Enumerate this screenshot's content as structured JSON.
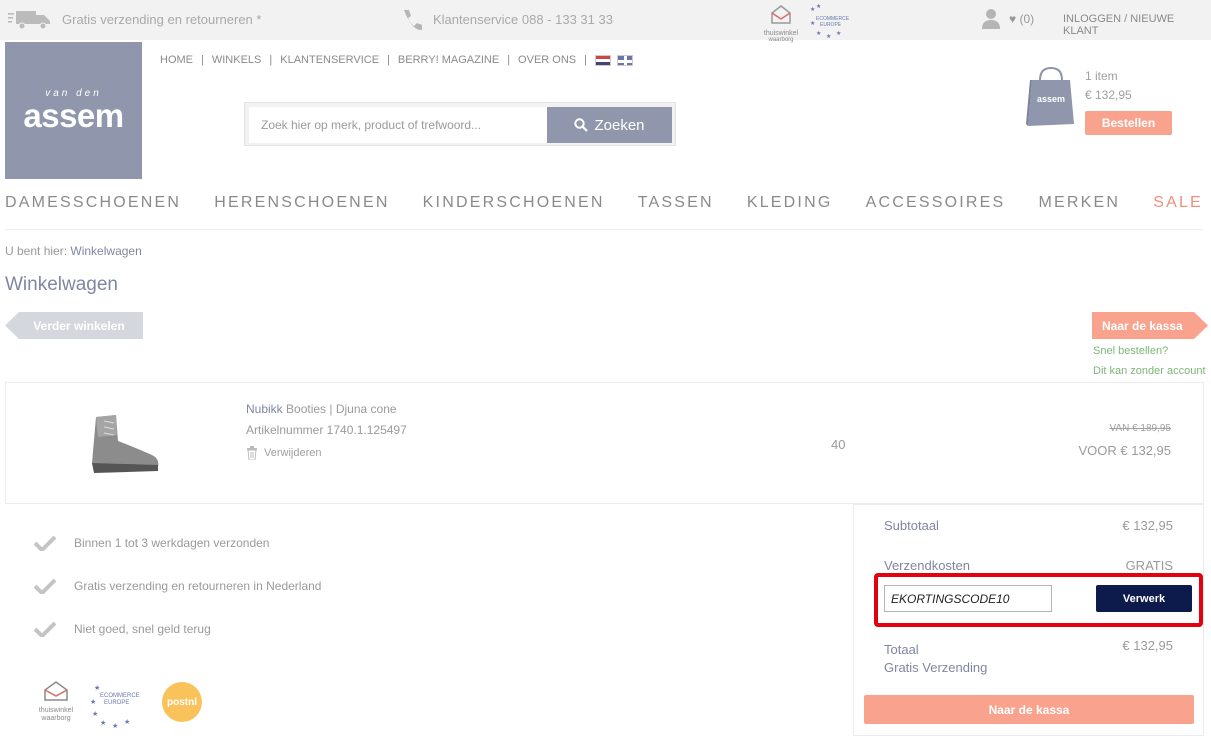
{
  "topbar": {
    "shipping_text": "Gratis verzending en retourneren *",
    "service_text": "Klantenservice 088 - 133 31 33",
    "badge_tw_1": "thuiswinkel",
    "badge_tw_2": "waarborg",
    "badge_ec_1": "ECOMMERCE",
    "badge_ec_2": "EUROPE",
    "wishlist_count": "(0)",
    "login_text": "INLOGGEN / NIEUWE KLANT"
  },
  "brand": {
    "prefix": "van den",
    "name": "assem"
  },
  "mainlinks": {
    "home": "HOME",
    "stores": "WINKELS",
    "service": "KLANTENSERVICE",
    "magazine": "BERRY! MAGAZINE",
    "about": "OVER ONS",
    "separator": "|"
  },
  "search": {
    "placeholder": "Zoek hier op merk, product of trefwoord...",
    "button": "Zoeken"
  },
  "minicart": {
    "bag_label": "assem",
    "count": "1 item",
    "total": "€ 132,95",
    "order_button": "Bestellen"
  },
  "catnav": [
    "DAMESSCHOENEN",
    "HERENSCHOENEN",
    "KINDERSCHOENEN",
    "TASSEN",
    "KLEDING",
    "ACCESSOIRES",
    "MERKEN",
    "SALE"
  ],
  "breadcrumb": {
    "prefix": "U bent hier:",
    "current": "Winkelwagen"
  },
  "page_title": "Winkelwagen",
  "actions": {
    "continue_shopping": "Verder winkelen",
    "checkout": "Naar de kassa",
    "quick_order": "Snel bestellen?",
    "no_account": "Dit kan zonder account"
  },
  "cart_item": {
    "brand": "Nubikk",
    "name": "Booties | Djuna cone",
    "article": "Artikelnummer 1740.1.125497",
    "remove": "Verwijderen",
    "size": "40",
    "price_old": "VAN € 189,95",
    "price_new": "VOOR € 132,95"
  },
  "usps": [
    "Binnen 1 tot 3 werkdagen verzonden",
    "Gratis verzending en retourneren in Nederland",
    "Niet goed, snel geld terug"
  ],
  "footer_logos": {
    "tw_1": "thuiswinkel",
    "tw_2": "waarborg",
    "ec_1": "ECOMMERCE",
    "ec_2": "EUROPE",
    "postnl": "postnl"
  },
  "summary": {
    "subtotal_label": "Subtotaal",
    "subtotal_value": "€ 132,95",
    "shipping_label": "Verzendkosten",
    "shipping_value": "GRATIS",
    "discount_code_value": "EKORTINGSCODE10",
    "apply_button": "Verwerk",
    "total_label": "Totaal",
    "total_sub": "Gratis Verzending",
    "total_value": "€ 132,95",
    "checkout_button": "Naar de kassa"
  },
  "colors": {
    "brand": "#9097ac",
    "accent": "#f9a38e",
    "navy": "#0c1a4c",
    "highlight": "#e3000f",
    "green": "#7fb67a"
  }
}
